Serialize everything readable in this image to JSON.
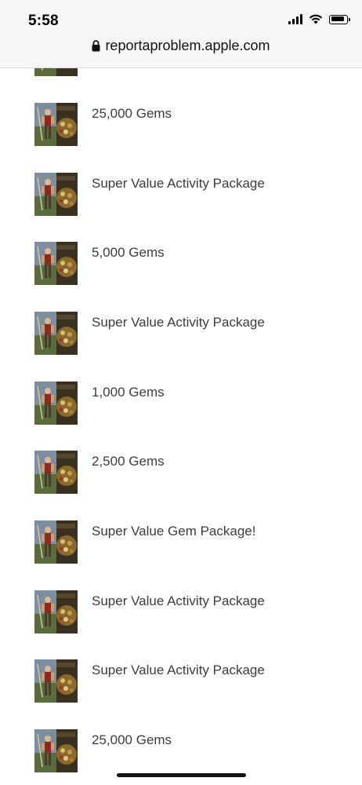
{
  "status_bar": {
    "time": "5:58",
    "icons": [
      "signal-icon",
      "wifi-icon",
      "battery-icon"
    ]
  },
  "url_bar": {
    "lock_icon": "lock-icon",
    "url": "reportaproblem.apple.com"
  },
  "purchases": [
    {
      "title": ""
    },
    {
      "title": "25,000 Gems"
    },
    {
      "title": "Super Value Activity Package"
    },
    {
      "title": "5,000 Gems"
    },
    {
      "title": "Super Value Activity Package"
    },
    {
      "title": "1,000 Gems"
    },
    {
      "title": "2,500 Gems"
    },
    {
      "title": "Super Value Gem Package!"
    },
    {
      "title": "Super Value Activity Package"
    },
    {
      "title": "Super Value Activity Package"
    },
    {
      "title": "25,000 Gems"
    }
  ],
  "colors": {
    "header_bg": "#f6f6f6",
    "text": "#3c3c3c"
  }
}
